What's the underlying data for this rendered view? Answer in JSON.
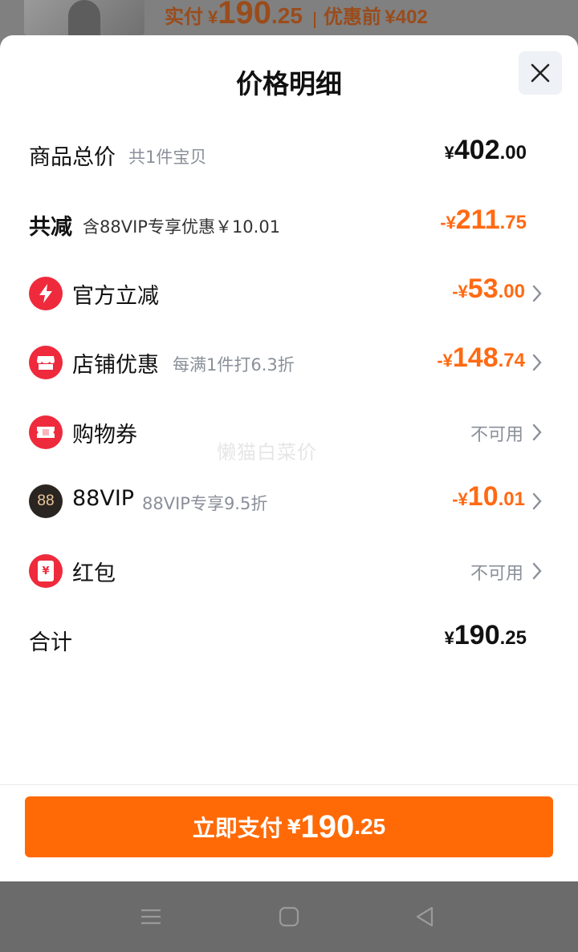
{
  "header": {
    "paid_label": "实付",
    "paid_symbol": "¥",
    "paid_int": "190",
    "paid_dec": ".25",
    "before_label": "优惠前",
    "before_value": "¥402"
  },
  "sheet": {
    "title": "价格明细"
  },
  "rows": {
    "total": {
      "label": "商品总价",
      "sub": "共1件宝贝",
      "sym": "¥",
      "int": "402",
      "dec": ".00"
    },
    "reduce": {
      "label": "共减",
      "sub": "含88VIP专享优惠￥10.01",
      "sym": "-¥",
      "int": "211",
      "dec": ".75"
    },
    "official": {
      "label": "官方立减",
      "sym": "-¥",
      "int": "53",
      "dec": ".00"
    },
    "store": {
      "label": "店铺优惠",
      "sub": "每满1件打6.3折",
      "sym": "-¥",
      "int": "148",
      "dec": ".74"
    },
    "coupon": {
      "label": "购物券",
      "status": "不可用"
    },
    "vip": {
      "label": "88VIP",
      "sub": "88VIP专享9.5折",
      "icon_text": "88",
      "sym": "-¥",
      "int": "10",
      "dec": ".01"
    },
    "redpacket": {
      "label": "红包",
      "status": "不可用",
      "icon_text": "¥"
    },
    "sum": {
      "label": "合计",
      "sym": "¥",
      "int": "190",
      "dec": ".25"
    }
  },
  "watermark": "懒猫白菜价",
  "pay_button": {
    "label": "立即支付",
    "sym": "¥",
    "int": "190",
    "dec": ".25"
  },
  "colors": {
    "accent": "#ff6a07",
    "discount": "#ff6a13",
    "icon_red": "#ee2a3c",
    "muted": "#8a8f99"
  }
}
